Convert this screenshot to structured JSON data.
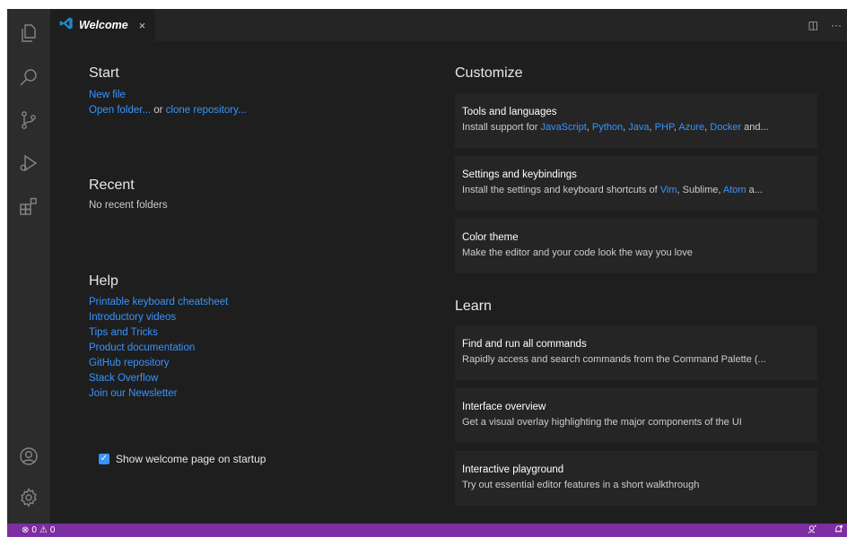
{
  "tab": {
    "title": "Welcome",
    "close": "×"
  },
  "editor_actions": {
    "split": "◫",
    "more": "···"
  },
  "start": {
    "heading": "Start",
    "new_file": "New file",
    "open_folder": "Open folder...",
    "or": "or",
    "clone_repo": "clone repository..."
  },
  "recent": {
    "heading": "Recent",
    "empty": "No recent folders"
  },
  "help": {
    "heading": "Help",
    "links": [
      "Printable keyboard cheatsheet",
      "Introductory videos",
      "Tips and Tricks",
      "Product documentation",
      "GitHub repository",
      "Stack Overflow",
      "Join our Newsletter"
    ]
  },
  "startup": {
    "label": "Show welcome page on startup",
    "checked": true
  },
  "customize": {
    "heading": "Customize",
    "tools": {
      "title": "Tools and languages",
      "prefix": "Install support for ",
      "langs": [
        "JavaScript",
        "Python",
        "Java",
        "PHP",
        "Azure",
        "Docker"
      ],
      "suffix": " and..."
    },
    "settings": {
      "title": "Settings and keybindings",
      "prefix": "Install the settings and keyboard shortcuts of ",
      "vim": "Vim",
      "mid": ", Sublime, ",
      "atom": "Atom",
      "suffix": " a..."
    },
    "theme": {
      "title": "Color theme",
      "desc": "Make the editor and your code look the way you love"
    }
  },
  "learn": {
    "heading": "Learn",
    "cards": [
      {
        "title": "Find and run all commands",
        "desc": "Rapidly access and search commands from the Command Palette (..."
      },
      {
        "title": "Interface overview",
        "desc": "Get a visual overlay highlighting the major components of the UI"
      },
      {
        "title": "Interactive playground",
        "desc": "Try out essential editor features in a short walkthrough"
      }
    ]
  },
  "status": {
    "errors": "0",
    "warnings": "0"
  },
  "colors": {
    "accent": "#3794ff",
    "status_bar": "#7d2ea0",
    "background": "#1e1e1e"
  }
}
